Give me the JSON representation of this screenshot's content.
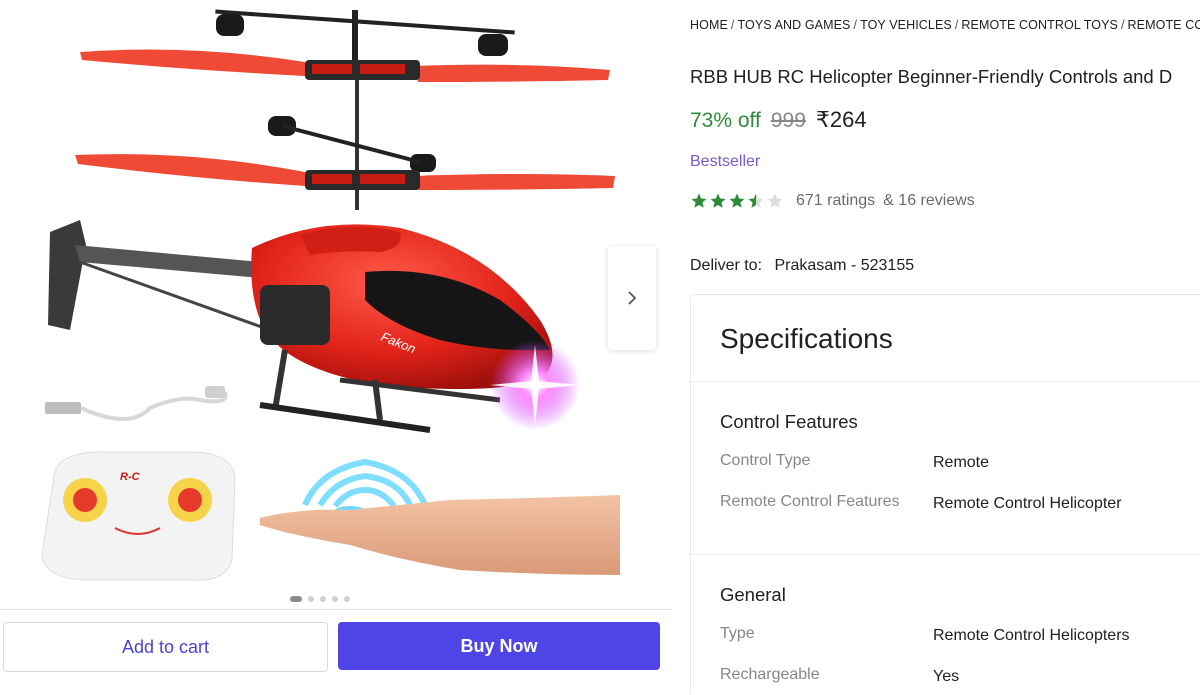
{
  "breadcrumb": [
    "HOME",
    "TOYS AND GAMES",
    "TOY VEHICLES",
    "REMOTE CONTROL TOYS",
    "REMOTE CONTR"
  ],
  "product": {
    "title": "RBB HUB RC Helicopter Beginner-Friendly Controls and D",
    "discount": "73% off",
    "mrp": "999",
    "price": "₹264",
    "badge": "Bestseller",
    "rating_stars": 3.5,
    "ratings": "671 ratings",
    "reviews": "& 16 reviews",
    "deliver_label": "Deliver to:",
    "deliver_location": "Prakasam - 523155"
  },
  "images": {
    "remote_logo": "R-C",
    "decal": "Fakon",
    "current": 1,
    "total": 5
  },
  "actions": {
    "add_to_cart": "Add to cart",
    "buy_now": "Buy Now"
  },
  "specs": {
    "title": "Specifications",
    "groups": [
      {
        "name": "Control Features",
        "rows": [
          {
            "key": "Control Type",
            "value": "Remote"
          },
          {
            "key": "Remote Control Features",
            "value": "Remote Control Helicopter"
          }
        ]
      },
      {
        "name": "General",
        "rows": [
          {
            "key": "Type",
            "value": "Remote Control Helicopters"
          },
          {
            "key": "Rechargeable",
            "value": "Yes"
          }
        ]
      }
    ]
  },
  "colors": {
    "discount": "#2e8b3a",
    "badge": "#7a5cc6",
    "star": "#2e8b3a",
    "buy_button": "#4f44e6",
    "cart_text": "#4a44d6"
  },
  "icons": {
    "next": "chevron-right-icon",
    "star": "star-icon"
  }
}
